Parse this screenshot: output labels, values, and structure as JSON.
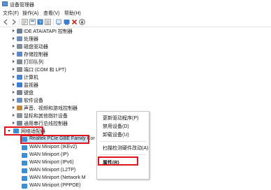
{
  "window": {
    "title": "设备管理器"
  },
  "menu": [
    "文件(F)",
    "操作(A)",
    "查看(V)",
    "帮助(H)"
  ],
  "tree": {
    "categories": [
      {
        "label": "IDE ATA/ATAPI 控制器",
        "color": "#6d7f95"
      },
      {
        "label": "处理器",
        "color": "#6f8fb8"
      },
      {
        "label": "磁盘驱动器",
        "color": "#7f8c99"
      },
      {
        "label": "存储控制器",
        "color": "#5b89c7"
      },
      {
        "label": "打印队列",
        "color": "#808b96"
      },
      {
        "label": "端口 (COM 和 LPT)",
        "color": "#8a8f96"
      },
      {
        "label": "计算机",
        "color": "#4b86cf"
      },
      {
        "label": "监视器",
        "color": "#3c7fd0"
      },
      {
        "label": "键盘",
        "color": "#7a8490"
      },
      {
        "label": "软件设备",
        "color": "#6c8fbd"
      },
      {
        "label": "声音、视频和游戏控制器",
        "color": "#c08a3e"
      },
      {
        "label": "鼠标和其他指针设备",
        "color": "#8b939c"
      },
      {
        "label": "通用串行总线控制器",
        "color": "#7b8794"
      }
    ],
    "network_category": {
      "label": "网络适配器",
      "color": "#3b8fd8"
    },
    "adapters": [
      "Realtek PCIe GBE Family Cor",
      "WAN Miniport (IKEv2)",
      "WAN Miniport (IP)",
      "WAN Miniport (IPv6)",
      "WAN Miniport (L2TP)",
      "WAN Miniport (Network M",
      "WAN Miniport (PPPOE)"
    ]
  },
  "context_menu": {
    "items": [
      "更新驱动程序(P)",
      "禁用设备(D)",
      "卸载设备(U)",
      "扫描检测硬件改动(A)",
      "属性(R)"
    ]
  },
  "colors": {
    "highlight": "#e0141c",
    "selection": "#cce4f7"
  }
}
